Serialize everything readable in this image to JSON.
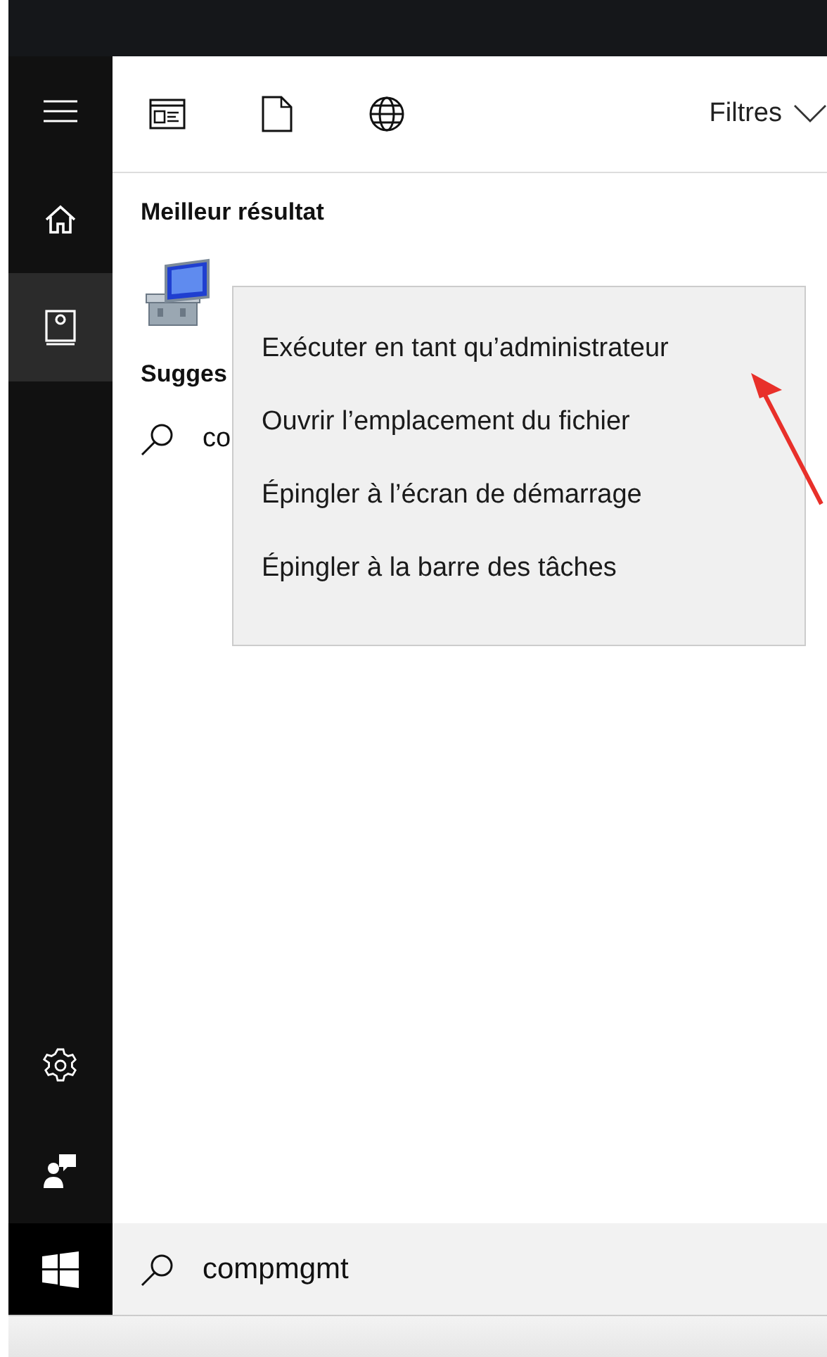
{
  "sidebar": {
    "items": [
      {
        "kind": "menu",
        "selected": false
      },
      {
        "kind": "home",
        "selected": false
      },
      {
        "kind": "notebook",
        "selected": true
      }
    ],
    "bottom_items": [
      {
        "kind": "settings"
      },
      {
        "kind": "feedback"
      }
    ]
  },
  "toolbar": {
    "filters_label": "Filtres"
  },
  "best_result": {
    "heading": "Meilleur résultat"
  },
  "suggestions": {
    "heading": "Sugges",
    "items": [
      {
        "text": "co"
      }
    ]
  },
  "context_menu": {
    "items": [
      {
        "label": "Exécuter en tant qu’administrateur"
      },
      {
        "label": "Ouvrir l’emplacement du fichier"
      },
      {
        "label": "Épingler à l’écran de démarrage"
      },
      {
        "label": "Épingler à la barre des tâches"
      }
    ]
  },
  "search_box": {
    "value": "compmgmt"
  }
}
